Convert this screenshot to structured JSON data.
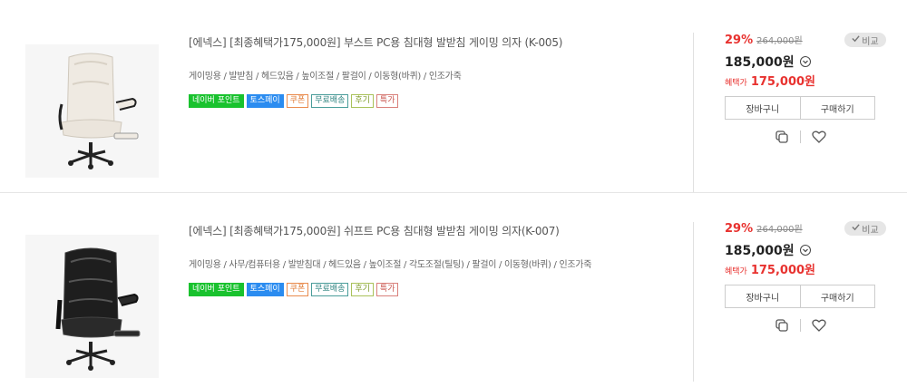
{
  "products": [
    {
      "title": "[에넥스] [최종혜택가175,000원] 부스트 PC용 침대형 발받침 게이밍 의자 (K-005)",
      "specs": "게이밍용 / 발받침 / 헤드있음 / 높이조절 / 팔걸이 / 이동형(바퀴) / 인조가죽",
      "tags": [
        "네이버 포인트",
        "토스페이",
        "쿠폰",
        "무료배송",
        "후기",
        "특가"
      ],
      "discount": "29%",
      "original_price": "264,000원",
      "price": "185,000원",
      "benefit_label": "혜택가",
      "benefit_price": "175,000원",
      "compare_label": "비교",
      "cart_label": "장바구니",
      "buy_label": "구매하기",
      "chair_color": "#efeae2",
      "compare_icon": "check-icon",
      "copy_icon": "copy-icon",
      "wish_icon": "heart-icon"
    },
    {
      "title": "[에넥스] [최종혜택가175,000원] 쉬프트 PC용 침대형 발받침 게이밍 의자(K-007)",
      "specs": "게이밍용 / 사무/컴퓨터용 / 발받침대 / 헤드있음 / 높이조절 / 각도조절(틸팅) / 팔걸이 / 이동형(바퀴) / 인조가죽",
      "tags": [
        "네이버 포인트",
        "토스페이",
        "쿠폰",
        "무료배송",
        "후기",
        "특가"
      ],
      "discount": "29%",
      "original_price": "264,000원",
      "price": "185,000원",
      "benefit_label": "혜택가",
      "benefit_price": "175,000원",
      "compare_label": "비교",
      "cart_label": "장바구니",
      "buy_label": "구매하기",
      "chair_color": "#1e1e1e",
      "compare_icon": "check-icon",
      "copy_icon": "copy-icon",
      "wish_icon": "heart-icon"
    }
  ],
  "colors": {
    "discount_red": "#e8322f",
    "naver_green": "#19c22e",
    "toss_blue": "#2b8cf0"
  }
}
